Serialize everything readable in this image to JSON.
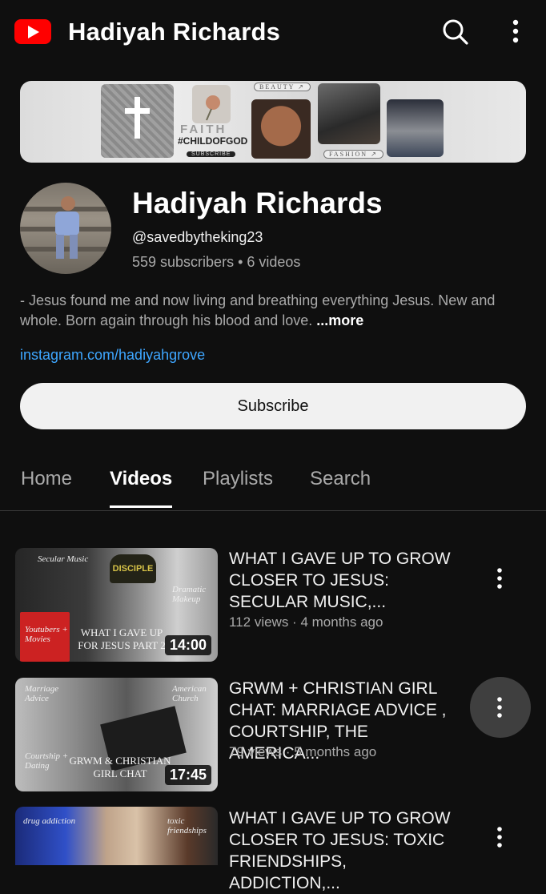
{
  "header": {
    "logo_icon": "youtube-logo-icon",
    "title": "Hadiyah Richards",
    "search_icon": "search-icon",
    "more_icon": "more-vert-icon"
  },
  "banner": {
    "faith": "FAITH",
    "hashtag": "#CHILDOFGOD",
    "subscribe": "SUBSCRIBE",
    "beauty": "BEAUTY ↗",
    "fashion": "FASHION ↗"
  },
  "channel": {
    "name": "Hadiyah Richards",
    "handle": "@savedbytheking23",
    "stats": "559 subscribers • 6 videos",
    "description": "- Jesus found me and now living and breathing everything Jesus. New and whole. Born again through his blood and love.",
    "more": "...more",
    "link": "instagram.com/hadiyahgrove",
    "subscribe_label": "Subscribe"
  },
  "tabs": [
    "Home",
    "Videos",
    "Playlists",
    "Search"
  ],
  "active_tab": "Videos",
  "videos": [
    {
      "title_lines": [
        "WHAT I GAVE UP TO GROW",
        "CLOSER TO JESUS:",
        "SECULAR MUSIC,..."
      ],
      "meta": "112 views · 4 months ago",
      "duration": "14:00",
      "thumb_caption": "WHAT I GAVE UP FOR JESUS PART 2",
      "thumb_labels": [
        "Secular Music",
        "Dramatic Makeup",
        "Youtubers + Movies",
        "DISCIPLE"
      ]
    },
    {
      "title_lines": [
        "GRWM + CHRISTIAN GIRL",
        "CHAT: MARRIAGE ADVICE ,",
        "COURTSHIP, THE AMERICA..."
      ],
      "meta": "79 views · 5 months ago",
      "duration": "17:45",
      "thumb_caption": "GRWM & CHRISTIAN GIRL CHAT",
      "thumb_labels": [
        "Marriage Advice",
        "American Church",
        "Courtship + Dating"
      ]
    },
    {
      "title_lines": [
        "WHAT I GAVE UP TO GROW",
        "CLOSER TO JESUS: TOXIC",
        "FRIENDSHIPS, ADDICTION,..."
      ],
      "meta": "",
      "duration": "",
      "thumb_caption": "",
      "thumb_labels": [
        "drug addiction",
        "toxic friendships"
      ]
    }
  ],
  "colors": {
    "background": "#0f0f0f",
    "accent_red": "#ff0000",
    "link_blue": "#3ea6ff",
    "secondary_text": "#aaaaaa"
  }
}
